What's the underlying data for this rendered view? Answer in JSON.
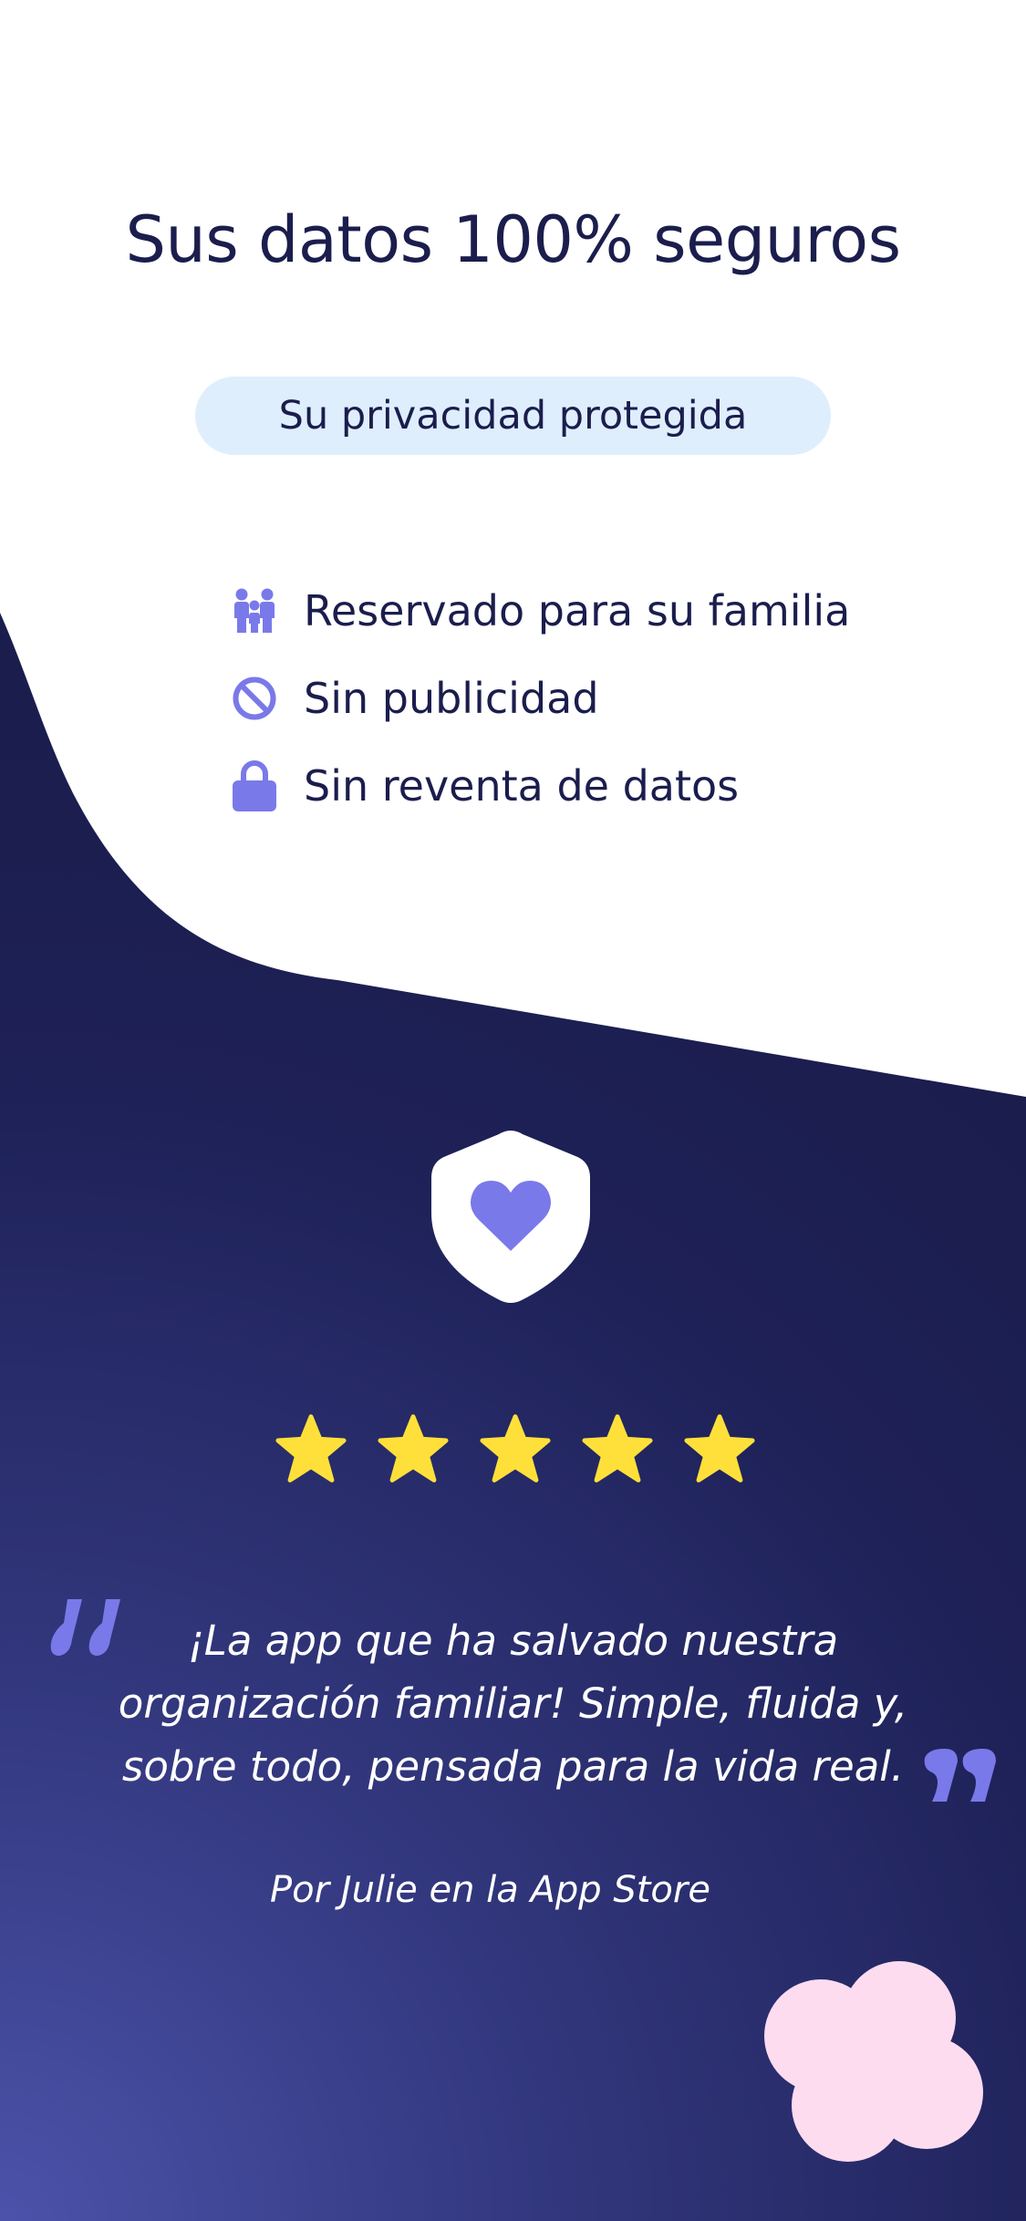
{
  "header": {
    "title": "Sus datos 100% seguros",
    "badge": "Su privacidad protegida"
  },
  "features": [
    {
      "icon": "family-icon",
      "label": "Reservado para su familia"
    },
    {
      "icon": "no-ads-icon",
      "label": "Sin publicidad"
    },
    {
      "icon": "lock-icon",
      "label": "Sin reventa de datos"
    }
  ],
  "rating": {
    "stars": 5,
    "max": 5
  },
  "testimonial": {
    "lines": [
      "¡La app que ha salvado nuestra",
      "organización familiar! Simple, fluida y,",
      "sobre todo, pensada para la vida real."
    ],
    "author": "Por Julie en la App Store"
  },
  "colors": {
    "title": "#1b1d4d",
    "badge_bg": "#dfeefd",
    "accent": "#7a79e9",
    "navy": "#1b1d4d",
    "gradient_light": "#4a4fa6",
    "star": "#ffe03a",
    "blob": "#fddcf0"
  }
}
